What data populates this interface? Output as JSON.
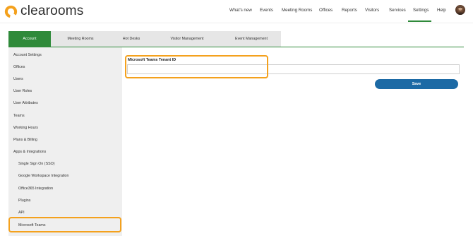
{
  "brand": {
    "name": "clearooms",
    "logo_icon": "clearooms-ring-logo",
    "accent": "#f4a11d",
    "green": "#2f8a3a",
    "blue": "#1c6aa5"
  },
  "nav": {
    "items": [
      {
        "label": "What's new"
      },
      {
        "label": "Events"
      },
      {
        "label": "Meeting Rooms"
      },
      {
        "label": "Offices"
      },
      {
        "label": "Reports"
      },
      {
        "label": "Visitors"
      },
      {
        "label": "Services"
      },
      {
        "label": "Settings",
        "active": true
      },
      {
        "label": "Help"
      }
    ],
    "avatar_icon": "user-avatar"
  },
  "tabs": [
    {
      "label": "Account",
      "active": true
    },
    {
      "label": "Meeting Rooms"
    },
    {
      "label": "Hot Desks"
    },
    {
      "label": "Visitor Management"
    },
    {
      "label": "Event Management"
    }
  ],
  "sidebar": {
    "items": [
      {
        "label": "Account Settings"
      },
      {
        "label": "Offices"
      },
      {
        "label": "Users"
      },
      {
        "label": "User Roles"
      },
      {
        "label": "User Attributes"
      },
      {
        "label": "Teams"
      },
      {
        "label": "Working Hours"
      },
      {
        "label": "Plans & Billing"
      },
      {
        "label": "Apps & Integrations"
      },
      {
        "label": "Single Sign On (SSO)",
        "sub": true
      },
      {
        "label": "Google Workspace Integration",
        "sub": true
      },
      {
        "label": "Office365 Integration",
        "sub": true
      },
      {
        "label": "Plugins",
        "sub": true
      },
      {
        "label": "API",
        "sub": true
      },
      {
        "label": "Microsoft Teams",
        "sub": true,
        "active": true
      }
    ]
  },
  "form": {
    "tenant_label": "Microsoft Teams Tenant ID",
    "tenant_value": "",
    "save_label": "Save"
  }
}
